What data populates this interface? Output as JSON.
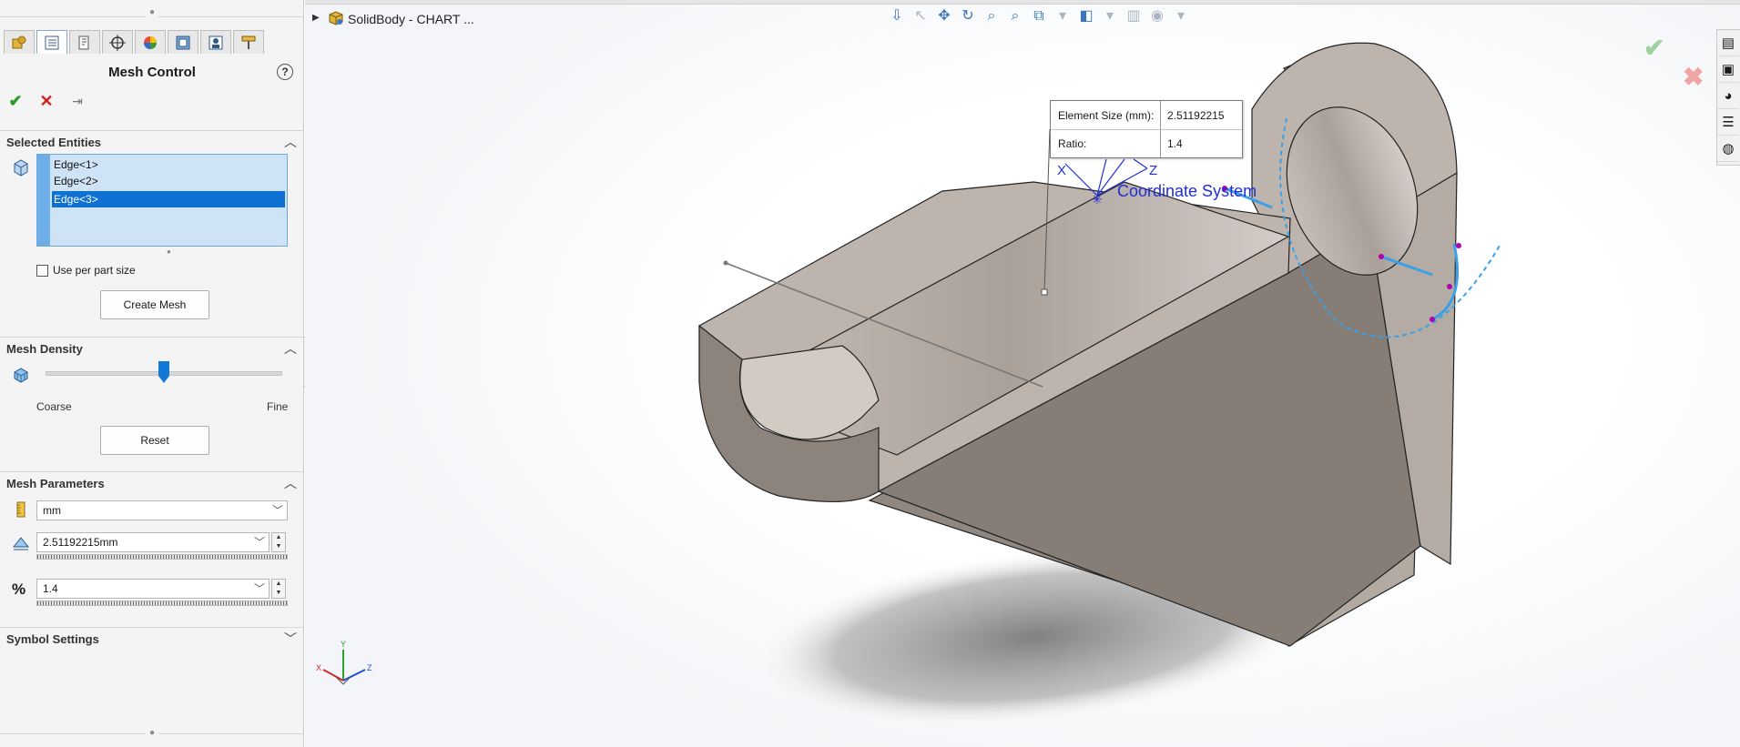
{
  "panel": {
    "title": "Mesh Control",
    "help_glyph": "?",
    "ok_glyph": "✔",
    "cancel_glyph": "✕",
    "pin_glyph": "⇥",
    "selected_entities": {
      "header": "Selected Entities",
      "items": [
        "Edge<1>",
        "Edge<2>",
        "Edge<3>"
      ],
      "selected_index": 2,
      "use_per_part_size_label": "Use per part size",
      "use_per_part_size_checked": false,
      "create_mesh_label": "Create Mesh"
    },
    "mesh_density": {
      "header": "Mesh Density",
      "coarse_label": "Coarse",
      "fine_label": "Fine",
      "level_fraction": 0.5,
      "reset_label": "Reset"
    },
    "mesh_parameters": {
      "header": "Mesh Parameters",
      "unit_value": "mm",
      "element_size_value": "2.51192215mm",
      "ratio_value": "1.4"
    },
    "symbol_settings": {
      "header": "Symbol Settings"
    }
  },
  "viewport": {
    "document_title": "SolidBody - CHART ...",
    "callout": {
      "element_size_label": "Element Size (mm):",
      "element_size_value": "2.51192215",
      "ratio_label": "Ratio:",
      "ratio_value": "1.4"
    },
    "coordinate_label": "Coordinate System",
    "axis_labels": {
      "x": "X",
      "y": "Y",
      "z": "Z"
    },
    "colors": {
      "selection_blue": "#0f72d3",
      "mesh_edge_blue": "#3aa0e8",
      "coord_blue": "#1f2fd4",
      "model_face_light": "#c1b8b0",
      "model_face_dark": "#8b827b"
    }
  }
}
